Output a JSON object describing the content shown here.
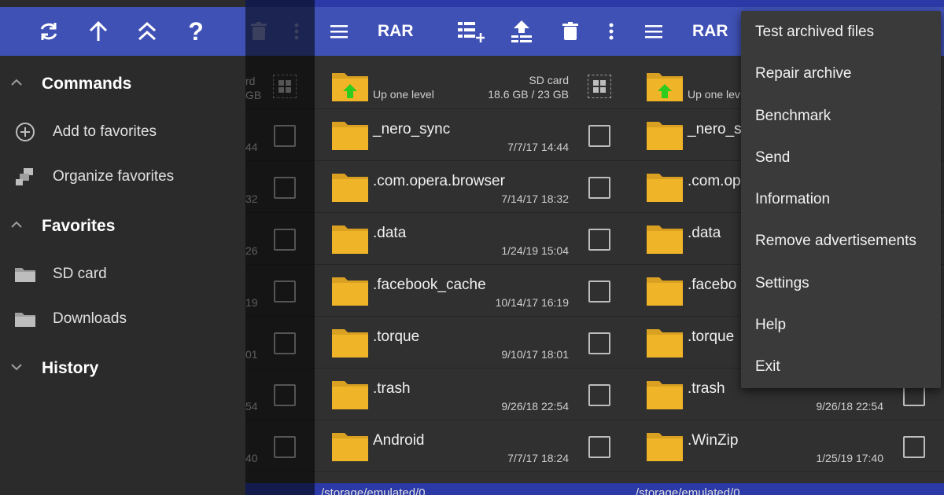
{
  "app": {
    "title": "RAR"
  },
  "colors": {
    "appbar": "#3f51b5",
    "statusbar": "#2c3aa8",
    "folder": "#f0b428",
    "up_arrow": "#2ecc1f",
    "background": "#303030"
  },
  "drawer": {
    "toolbar_icons": [
      "refresh-icon",
      "arrow-up-icon",
      "double-chevron-up-icon",
      "help-icon"
    ],
    "help_glyph": "?",
    "sections": [
      {
        "title": "Commands",
        "items": [
          {
            "label": "Add to favorites",
            "icon": "plus-circle-icon"
          },
          {
            "label": "Organize favorites",
            "icon": "organize-icon"
          }
        ]
      },
      {
        "title": "Favorites",
        "items": [
          {
            "label": "SD card",
            "icon": "folder-icon"
          },
          {
            "label": "Downloads",
            "icon": "folder-icon"
          }
        ]
      },
      {
        "title": "History",
        "items": []
      }
    ]
  },
  "behind_list_peek": {
    "top_text": "rd",
    "top_sub": "GB",
    "suffixes": [
      "44",
      "32",
      "26",
      "19",
      "01",
      "54",
      "40"
    ]
  },
  "up_row": {
    "label": "Up one level",
    "storage_name": "SD card",
    "storage_size": "18.6 GB / 23 GB"
  },
  "up_row_p3": {
    "label": "Up one lev"
  },
  "files_p2": [
    {
      "name": "_nero_sync",
      "date": "7/7/17 14:44"
    },
    {
      "name": ".com.opera.browser",
      "date": "7/14/17 18:32"
    },
    {
      "name": ".data",
      "date": "1/24/19 15:04"
    },
    {
      "name": ".facebook_cache",
      "date": "10/14/17 16:19"
    },
    {
      "name": ".torque",
      "date": "9/10/17 18:01"
    },
    {
      "name": ".trash",
      "date": "9/26/18 22:54"
    },
    {
      "name": "Android",
      "date": "7/7/17 18:24"
    }
  ],
  "files_p3": [
    {
      "name": "_nero_s",
      "date": ""
    },
    {
      "name": ".com.op",
      "date": ""
    },
    {
      "name": ".data",
      "date": ""
    },
    {
      "name": ".facebo",
      "date": ""
    },
    {
      "name": ".torque",
      "date": ""
    },
    {
      "name": ".trash",
      "date": "9/26/18 22:54"
    },
    {
      "name": ".WinZip",
      "date": "1/25/19 17:40"
    }
  ],
  "path": "/storage/emulated/0",
  "menu": {
    "items": [
      "Test archived files",
      "Repair archive",
      "Benchmark",
      "Send",
      "Information",
      "Remove advertisements",
      "Settings",
      "Help",
      "Exit"
    ]
  }
}
